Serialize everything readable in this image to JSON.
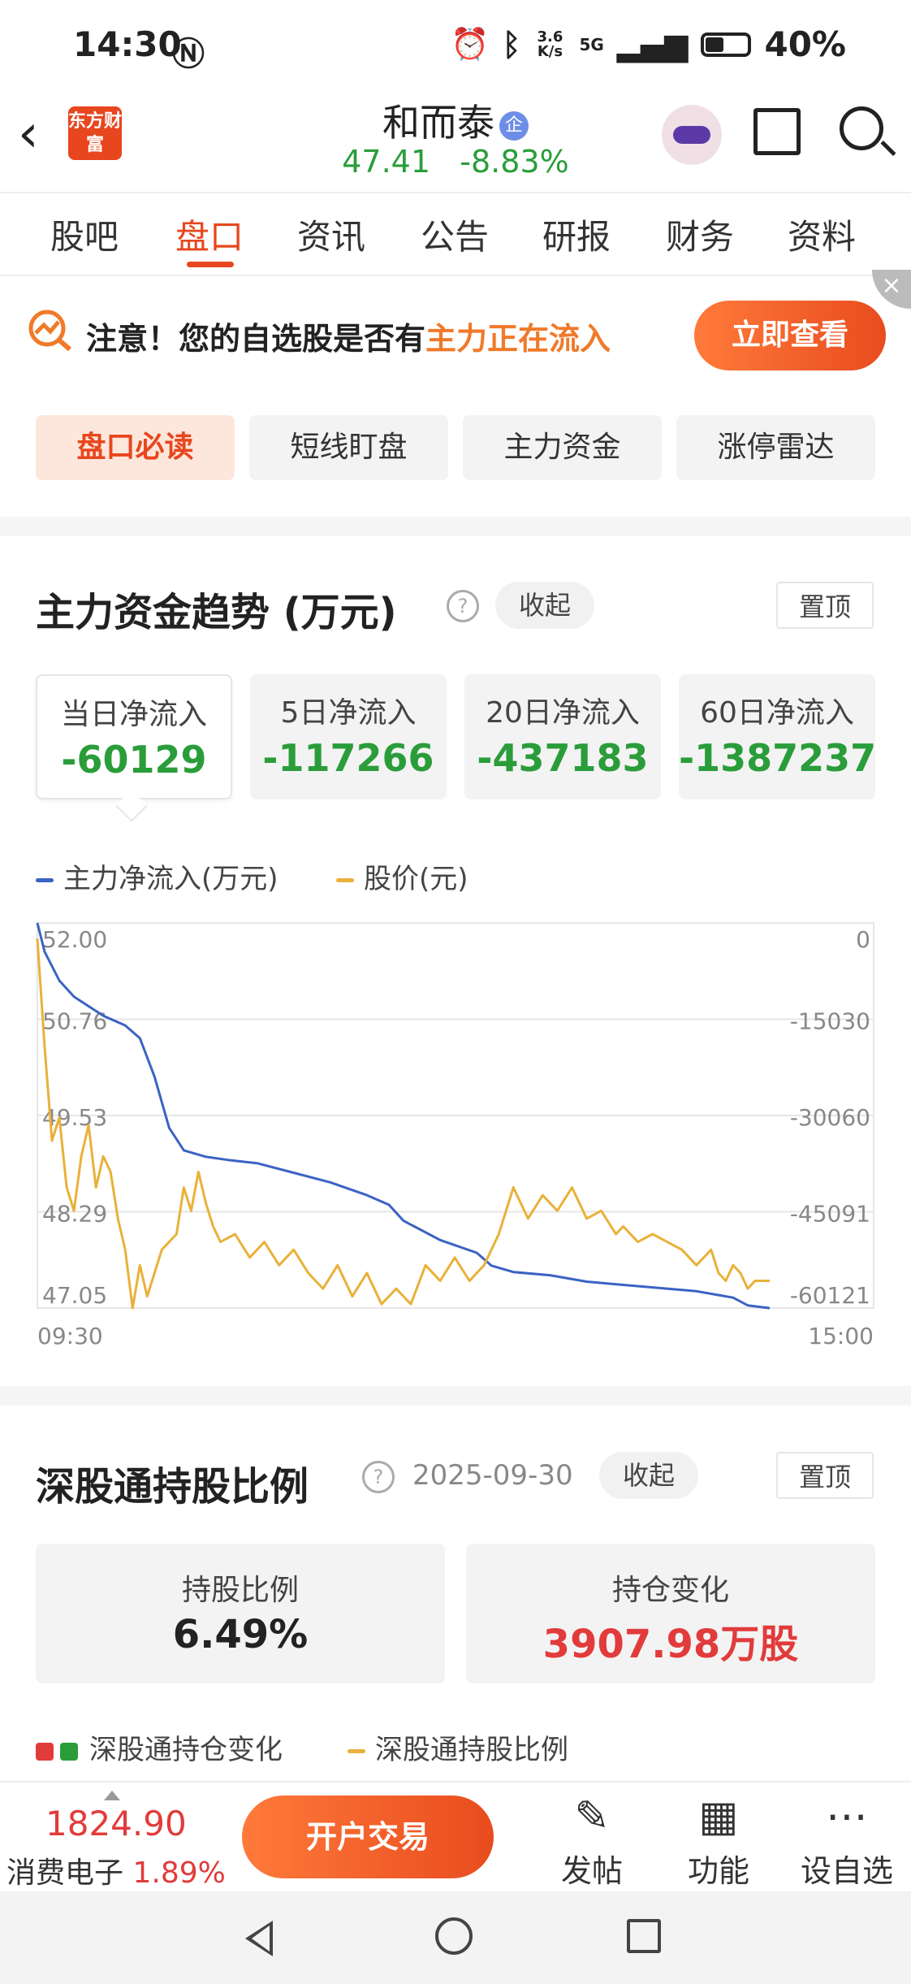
{
  "status_bar": {
    "time": "14:30",
    "net_speed": "3.6 K/s",
    "network": "5G",
    "battery": "40%"
  },
  "header": {
    "brand_logo": "东方财富",
    "stock_name": "和而泰",
    "badge": "企",
    "price": "47.41",
    "change_pct": "-8.83%"
  },
  "tabs": [
    "股吧",
    "盘口",
    "资讯",
    "公告",
    "研报",
    "财务",
    "资料"
  ],
  "active_tab": "盘口",
  "notice": {
    "text_a": "注意！您的自选股是否有",
    "text_b": "主力正在流入",
    "button": "立即查看",
    "close": "×"
  },
  "chips": [
    "盘口必读",
    "短线盯盘",
    "主力资金",
    "涨停雷达"
  ],
  "fund_section": {
    "title": "主力资金趋势 (万元)",
    "collapse": "收起",
    "pin": "置顶",
    "cards": [
      {
        "label": "当日净流入",
        "value": "-60129"
      },
      {
        "label": "5日净流入",
        "value": "-117266"
      },
      {
        "label": "20日净流入",
        "value": "-437183"
      },
      {
        "label": "60日净流入",
        "value": "-1387237"
      }
    ],
    "legend": [
      {
        "name": "主力净流入(万元)",
        "color": "#3b63c4"
      },
      {
        "name": "股价(元)",
        "color": "#e9b13a"
      }
    ]
  },
  "chart_data": {
    "type": "line",
    "left_axis_ticks": [
      "52.00",
      "50.76",
      "49.53",
      "48.29",
      "47.05"
    ],
    "right_axis_ticks": [
      "0",
      "-15030",
      "-30060",
      "-45091",
      "-60121"
    ],
    "x_tick_labels": [
      "09:30",
      "15:00"
    ],
    "left_ylim": [
      47.05,
      52.0
    ],
    "right_ylim": [
      -60121,
      0
    ],
    "grid": true,
    "series": [
      {
        "name": "主力净流入(万元)",
        "color": "#3b63c4",
        "axis": "right",
        "x": [
          0.0,
          0.01,
          0.03,
          0.05,
          0.07,
          0.09,
          0.12,
          0.14,
          0.16,
          0.18,
          0.2,
          0.23,
          0.26,
          0.3,
          0.35,
          0.4,
          0.45,
          0.48,
          0.5,
          0.55,
          0.6,
          0.62,
          0.65,
          0.7,
          0.75,
          0.8,
          0.85,
          0.9,
          0.95,
          0.97,
          1.0
        ],
        "values": [
          0,
          -4500,
          -9000,
          -11500,
          -13000,
          -14500,
          -16000,
          -18000,
          -24000,
          -32000,
          -35500,
          -36500,
          -37000,
          -37500,
          -39000,
          -40500,
          -42500,
          -44000,
          -46500,
          -49500,
          -51500,
          -53500,
          -54500,
          -55000,
          -56000,
          -56500,
          -57000,
          -57500,
          -58500,
          -59700,
          -60129
        ]
      },
      {
        "name": "股价(元)",
        "color": "#e9b13a",
        "axis": "left",
        "x": [
          0.0,
          0.01,
          0.02,
          0.03,
          0.04,
          0.05,
          0.06,
          0.07,
          0.08,
          0.09,
          0.1,
          0.11,
          0.12,
          0.13,
          0.14,
          0.15,
          0.17,
          0.19,
          0.2,
          0.21,
          0.22,
          0.23,
          0.24,
          0.25,
          0.27,
          0.29,
          0.31,
          0.33,
          0.35,
          0.37,
          0.39,
          0.41,
          0.43,
          0.45,
          0.47,
          0.49,
          0.51,
          0.53,
          0.55,
          0.57,
          0.59,
          0.61,
          0.63,
          0.65,
          0.67,
          0.69,
          0.71,
          0.73,
          0.74,
          0.75,
          0.77,
          0.79,
          0.8,
          0.82,
          0.84,
          0.86,
          0.88,
          0.9,
          0.92,
          0.93,
          0.94,
          0.95,
          0.96,
          0.97,
          0.98,
          1.0
        ],
        "values": [
          51.8,
          50.4,
          49.2,
          49.5,
          48.6,
          48.3,
          49.0,
          49.4,
          48.6,
          49.0,
          48.8,
          48.2,
          47.8,
          47.05,
          47.6,
          47.2,
          47.8,
          48.0,
          48.6,
          48.3,
          48.8,
          48.4,
          48.1,
          47.9,
          48.0,
          47.7,
          47.9,
          47.6,
          47.8,
          47.5,
          47.3,
          47.6,
          47.2,
          47.5,
          47.1,
          47.3,
          47.1,
          47.6,
          47.4,
          47.7,
          47.4,
          47.6,
          48.0,
          48.6,
          48.2,
          48.5,
          48.3,
          48.6,
          48.4,
          48.2,
          48.3,
          48.0,
          48.1,
          47.9,
          48.0,
          47.9,
          47.8,
          47.6,
          47.8,
          47.5,
          47.4,
          47.6,
          47.5,
          47.3,
          47.4,
          47.4
        ]
      }
    ]
  },
  "hk_section": {
    "title": "深股通持股比例",
    "date": "2025-09-30",
    "collapse": "收起",
    "pin": "置顶",
    "cards": [
      {
        "label": "持股比例",
        "value": "6.49%",
        "color": "#222222"
      },
      {
        "label": "持仓变化",
        "value": "3907.98万股",
        "color": "#e23b3b"
      }
    ],
    "legend_a": "深股通持仓变化",
    "legend_b": "深股通持股比例",
    "legend_colors": [
      "#e23b3b",
      "#2a9d3a",
      "#e9b13a"
    ]
  },
  "bottom_bar": {
    "index_value": "1824.90",
    "index_name": "消费电子",
    "index_pct": "1.89%",
    "trade_button": "开户交易",
    "actions": [
      {
        "label": "发帖",
        "icon": "edit-icon"
      },
      {
        "label": "功能",
        "icon": "grid-icon"
      },
      {
        "label": "设自选",
        "icon": "more-icon"
      }
    ]
  }
}
